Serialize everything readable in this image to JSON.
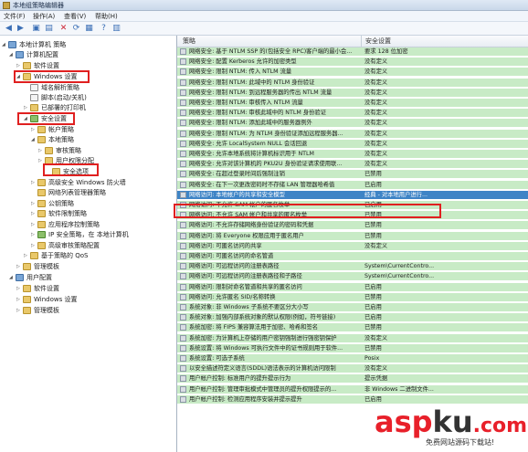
{
  "window": {
    "title": "本地组策略编辑器"
  },
  "menu": [
    {
      "label": "文件(F)"
    },
    {
      "label": "操作(A)"
    },
    {
      "label": "查看(V)"
    },
    {
      "label": "帮助(H)"
    }
  ],
  "toolbar": [
    {
      "icon": "back-arrow-icon",
      "glyph": "◀"
    },
    {
      "icon": "forward-arrow-icon",
      "glyph": "▶"
    },
    {
      "icon": "up-folder-icon",
      "glyph": "▣"
    },
    {
      "icon": "show-hide-tree-icon",
      "glyph": "▤"
    },
    {
      "icon": "delete-icon",
      "glyph": "✕"
    },
    {
      "icon": "refresh-icon",
      "glyph": "⟳"
    },
    {
      "icon": "export-list-icon",
      "glyph": "▦"
    },
    {
      "icon": "help-icon",
      "glyph": "?"
    },
    {
      "icon": "properties-icon",
      "glyph": "▥"
    }
  ],
  "tree": [
    {
      "label": "本地计算机 策略",
      "exp": "◢",
      "icon": "pc"
    },
    {
      "label": "计算机配置",
      "exp": "◢",
      "icon": "pc"
    },
    {
      "label": "软件设置",
      "exp": "▷",
      "icon": "folder"
    },
    {
      "label": "Windows 设置",
      "exp": "◢",
      "icon": "folder"
    },
    {
      "label": "域名解析策略",
      "exp": "",
      "icon": "doc"
    },
    {
      "label": "脚本(启动/关机)",
      "exp": "",
      "icon": "doc"
    },
    {
      "label": "已部署的打印机",
      "exp": "▷",
      "icon": "folder"
    },
    {
      "label": "安全设置",
      "exp": "◢",
      "icon": "sec"
    },
    {
      "label": "帐户策略",
      "exp": "▷",
      "icon": "folder"
    },
    {
      "label": "本地策略",
      "exp": "◢",
      "icon": "folder"
    },
    {
      "label": "审核策略",
      "exp": "▷",
      "icon": "folder"
    },
    {
      "label": "用户权限分配",
      "exp": "▷",
      "icon": "folder"
    },
    {
      "label": "安全选项",
      "exp": "",
      "icon": "folder"
    },
    {
      "label": "高级安全 Windows 防火墙",
      "exp": "▷",
      "icon": "folder"
    },
    {
      "label": "网络列表管理器策略",
      "exp": "",
      "icon": "folder"
    },
    {
      "label": "公钥策略",
      "exp": "▷",
      "icon": "folder"
    },
    {
      "label": "软件限制策略",
      "exp": "▷",
      "icon": "folder"
    },
    {
      "label": "应用程序控制策略",
      "exp": "▷",
      "icon": "folder"
    },
    {
      "label": "IP 安全策略，在 本地计算机",
      "exp": "▷",
      "icon": "sec"
    },
    {
      "label": "高级审核策略配置",
      "exp": "▷",
      "icon": "folder"
    },
    {
      "label": "基于策略的 QoS",
      "exp": "▷",
      "icon": "folder"
    },
    {
      "label": "管理模板",
      "exp": "▷",
      "icon": "folder"
    },
    {
      "label": "用户配置",
      "exp": "◢",
      "icon": "pc"
    },
    {
      "label": "软件设置",
      "exp": "▷",
      "icon": "folder"
    },
    {
      "label": "Windows 设置",
      "exp": "▷",
      "icon": "folder"
    },
    {
      "label": "管理模板",
      "exp": "▷",
      "icon": "folder"
    }
  ],
  "list": {
    "columns": {
      "policy": "策略",
      "setting": "安全设置"
    },
    "rows": [
      {
        "policy": "网络安全: 基于 NTLM SSP 的(包括安全 RPC)客户端的最小会...",
        "setting": "要求 128 位加密"
      },
      {
        "policy": "网络安全: 配置 Kerberos 允许的加密类型",
        "setting": "没有定义"
      },
      {
        "policy": "网络安全: 限制 NTLM: 传入 NTLM 流量",
        "setting": "没有定义"
      },
      {
        "policy": "网络安全: 限制 NTLM: 此域中的 NTLM 身份验证",
        "setting": "没有定义"
      },
      {
        "policy": "网络安全: 限制 NTLM: 到远程服务器的传出 NTLM 流量",
        "setting": "没有定义"
      },
      {
        "policy": "网络安全: 限制 NTLM: 审核传入 NTLM 流量",
        "setting": "没有定义"
      },
      {
        "policy": "网络安全: 限制 NTLM: 审核此域中的 NTLM 身份验证",
        "setting": "没有定义"
      },
      {
        "policy": "网络安全: 限制 NTLM: 添加此域中的服务器例外",
        "setting": "没有定义"
      },
      {
        "policy": "网络安全: 限制 NTLM: 为 NTLM 身份验证添加远程服务器...",
        "setting": "没有定义"
      },
      {
        "policy": "网络安全: 允许 LocalSystem NULL 会话回退",
        "setting": "没有定义"
      },
      {
        "policy": "网络安全: 允许本地系统将计算机标识用于 NTLM",
        "setting": "没有定义"
      },
      {
        "policy": "网络安全: 允许对该计算机的 PKU2U 身份验证请求使用联...",
        "setting": "没有定义"
      },
      {
        "policy": "网络安全: 在超过登录时间后强制注销",
        "setting": "已禁用"
      },
      {
        "policy": "网络安全: 在下一次更改密码时不存储 LAN 管理器哈希值",
        "setting": "已启用"
      },
      {
        "policy": "网络访问: 本地帐户的共享和安全模型",
        "setting": "经典 - 对本地用户进行..."
      },
      {
        "policy": "网络访问: 不允许 SAM 帐户的匿名枚举",
        "setting": "已启用"
      },
      {
        "policy": "网络访问: 不允许 SAM 帐户和共享的匿名枚举",
        "setting": "已禁用"
      },
      {
        "policy": "网络访问: 不允许存储网络身份验证的密码和凭据",
        "setting": "已禁用"
      },
      {
        "policy": "网络访问: 将 Everyone 权限应用于匿名用户",
        "setting": "已禁用"
      },
      {
        "policy": "网络访问: 可匿名访问的共享",
        "setting": "没有定义"
      },
      {
        "policy": "网络访问: 可匿名访问的命名管道",
        "setting": ""
      },
      {
        "policy": "网络访问: 可远程访问的注册表路径",
        "setting": "System\\CurrentContro..."
      },
      {
        "policy": "网络访问: 可远程访问的注册表路径和子路径",
        "setting": "System\\CurrentContro..."
      },
      {
        "policy": "网络访问: 限制对命名管道和共享的匿名访问",
        "setting": "已启用"
      },
      {
        "policy": "网络访问: 允许匿名 SID/名称转换",
        "setting": "已禁用"
      },
      {
        "policy": "系统对象: 非 Windows 子系统不要区分大小写",
        "setting": "已启用"
      },
      {
        "policy": "系统对象: 加强内部系统对象的默认权限(例如，符号链接)",
        "setting": "已启用"
      },
      {
        "policy": "系统加密: 将 FIPS 兼容算法用于加密、哈希和签名",
        "setting": "已禁用"
      },
      {
        "policy": "系统加密: 为计算机上存储的用户密钥强制进行强密钥保护",
        "setting": "没有定义"
      },
      {
        "policy": "系统设置: 将 Windows 可执行文件中的证书规则用于软件...",
        "setting": "已禁用"
      },
      {
        "policy": "系统设置: 可选子系统",
        "setting": "Posix"
      },
      {
        "policy": "以安全描述符定义语言(SDDL)语法表示的计算机访问限制",
        "setting": "没有定义"
      },
      {
        "policy": "用户帐户控制: 标准用户的提升提示行为",
        "setting": "提示凭据"
      },
      {
        "policy": "用户帐户控制: 管理审批模式中管理员的提升权限提示的...",
        "setting": "非 Windows 二进制文件..."
      },
      {
        "policy": "用户帐户控制: 检测应用程序安装并提示提升",
        "setting": "已启用"
      }
    ]
  },
  "watermark": {
    "brand1": "asp",
    "brand2": "ku",
    "brand3": ".com",
    "tagline": "免费网站源码下载站!"
  },
  "colors": {
    "highlight": "#e02020",
    "selection": "#3e84c6",
    "row_bg": "#c8ebc6"
  }
}
